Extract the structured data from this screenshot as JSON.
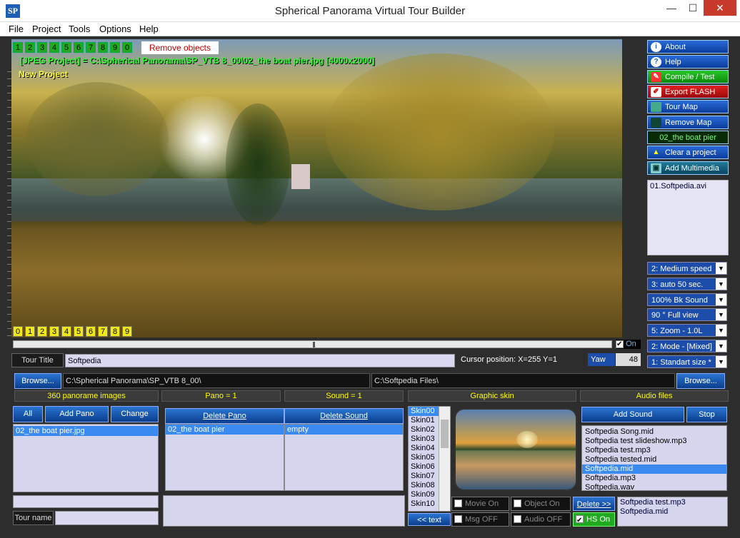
{
  "window": {
    "title": "Spherical Panorama Virtual Tour Builder",
    "icon_text": "SP",
    "minimize": "—",
    "maximize": "☐",
    "close": "✕"
  },
  "menu": [
    "File",
    "Project",
    "Tools",
    "Options",
    "Help"
  ],
  "viewer": {
    "top_numbers": [
      "1",
      "2",
      "3",
      "4",
      "5",
      "6",
      "7",
      "8",
      "9",
      "0"
    ],
    "bottom_numbers": [
      "0",
      "1",
      "2",
      "3",
      "4",
      "5",
      "6",
      "7",
      "8",
      "9"
    ],
    "remove_objects": "Remove objects",
    "project_path": "[JPEG Project] = C:\\Spherical Panorama\\SP_VTB 8_00\\02_the boat pier.jpg [4000x2000]",
    "project_name": "New Project",
    "on_label": "On"
  },
  "right_panel": {
    "buttons": [
      "About",
      "Help",
      "Compile / Test",
      "Export FLASH",
      "Tour Map",
      "Remove Map"
    ],
    "current_pano": "02_the boat pier",
    "clear_project": "Clear a project",
    "add_multimedia": "Add Multimedia",
    "media_items": [
      "01.Softpedia.avi"
    ],
    "selects": [
      "2: Medium speed",
      "3: auto 50 sec.",
      "100% Bk Sound",
      "90 ° Full view",
      "5: Zoom - 1.0L",
      "2: Mode - [Mixed]",
      "1: Standart size *"
    ]
  },
  "tour": {
    "title_label": "Tour Title",
    "title_value": "Softpedia",
    "cursor_position": "Cursor position: X=255  Y=1",
    "yaw_label": "Yaw",
    "yaw_value": "48"
  },
  "paths": {
    "browse1": "Browse...",
    "path1": "C:\\Spherical Panorama\\SP_VTB 8_00\\",
    "path2": "C:\\Softpedia Files\\",
    "browse2": "Browse..."
  },
  "group_labels": {
    "panos": "360 panorame images",
    "pano_count": "Pano =  1",
    "sound_count": "Sound =  1",
    "graphic_skin": "Graphic skin",
    "audio_files": "Audio files"
  },
  "pano_panel": {
    "all": "All",
    "add_pano": "Add Pano",
    "change": "Change",
    "items": [
      "02_the boat pier.jpg"
    ],
    "tour_name_label": "Tour name"
  },
  "mid_panel": {
    "delete_pano": "Delete Pano",
    "delete_sound": "Delete Sound",
    "pano_items": [
      "02_the boat pier"
    ],
    "sound_items": [
      "empty"
    ]
  },
  "skins": {
    "items": [
      "Skin00",
      "Skin01",
      "Skin02",
      "Skin03",
      "Skin04",
      "Skin05",
      "Skin06",
      "Skin07",
      "Skin08",
      "Skin09",
      "Skin10"
    ],
    "text_button": "<< text",
    "toggles": [
      "Movie On",
      "Object On",
      "Msg OFF",
      "Audio OFF"
    ]
  },
  "sound_panel": {
    "add_sound": "Add Sound",
    "stop": "Stop",
    "items": [
      "Softpedia Song.mid",
      "Softpedia test slideshow.mp3",
      "Softpedia test.mp3",
      "Softpedia tested.mid",
      "Softpedia.mid",
      "Softpedia.mp3",
      "Softpedia.wav"
    ],
    "selected_index": 4,
    "delete": "Delete >>",
    "hs_on": "HS On",
    "hs_items": [
      "Softpedia test.mp3",
      "Softpedia.mid"
    ]
  }
}
